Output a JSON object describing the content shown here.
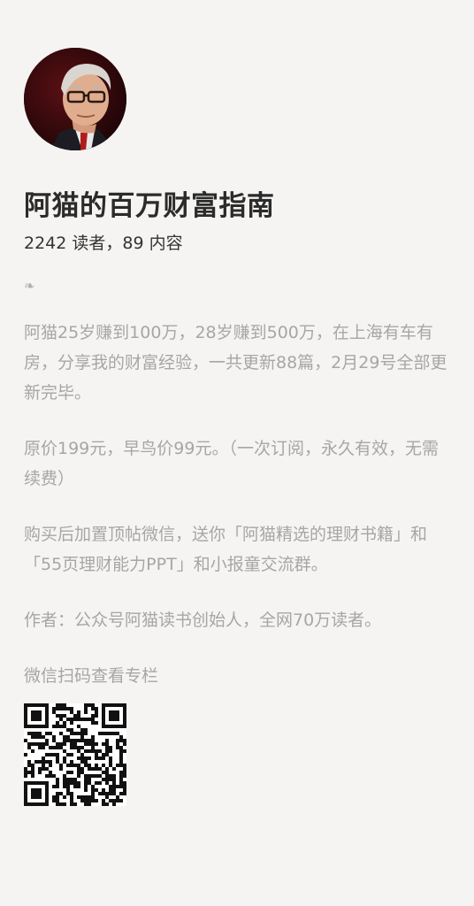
{
  "profile": {
    "title": "阿猫的百万财富指南",
    "stats": "2242 读者，89 内容",
    "ornament": "❧"
  },
  "description": {
    "p1": "阿猫25岁赚到100万，28岁赚到500万，在上海有车有房，分享我的财富经验，一共更新88篇，2月29号全部更新完毕。",
    "p2": "原价199元，早鸟价99元。（一次订阅，永久有效，无需续费）",
    "p3": "购买后加置顶帖微信，送你「阿猫精选的理财书籍」和「55页理财能力PPT」和小报童交流群。",
    "p4": "作者：公众号阿猫读书创始人，全网70万读者。",
    "scan_label": "微信扫码查看专栏"
  },
  "colors": {
    "background": "#f6f4f2",
    "title": "#2b2b2b",
    "body_text": "#a6a6a6"
  },
  "icons": {
    "avatar": "profile-photo",
    "ornament": "floral-heart-icon",
    "qr": "qr-code"
  }
}
